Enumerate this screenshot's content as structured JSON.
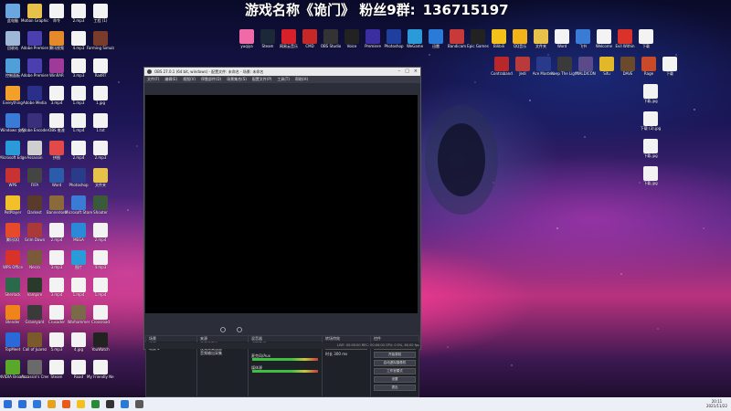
{
  "banner": {
    "game": "游戏名称《诡门》 粉丝9群:",
    "number": "136715197"
  },
  "obs": {
    "title": "OBS 27.0.1 (64 bit, windows) - 配置文件: 未命名 - 场景: 未命名",
    "menu": [
      "文件(F)",
      "编辑(E)",
      "视图(V)",
      "停靠部件(D)",
      "场景集合(S)",
      "配置文件(P)",
      "工具(T)",
      "帮助(H)"
    ],
    "docks": {
      "scenes_title": "场景",
      "scenes": [
        "场景",
        "场景 2"
      ],
      "sources_title": "来源",
      "sources": [
        "显示器采集",
        "视频采集设备",
        "音频输出采集"
      ],
      "mixer_title": "混音器",
      "mixer": [
        "桌面音频",
        "麦克风/Aux",
        "媒体源"
      ],
      "transitions_title": "转场特效",
      "transition_label": "淡入淡出",
      "duration_label": "时长",
      "duration_value": "300 ms",
      "controls_title": "控件",
      "controls": [
        "开始推流",
        "开始录制",
        "启动虚拟摄像机",
        "工作室模式",
        "设置",
        "退出"
      ]
    },
    "status": "LIVE: 00:00:00   REC: 00:00:00   CPU: 0.5%, 60.00 fps"
  },
  "desktop_left": [
    [
      "此电脑",
      "#6aa7e0"
    ],
    [
      "Motion Graphics",
      "#e7c24a"
    ],
    [
      "命令",
      "#f3f3f3"
    ],
    [
      "2.mp3",
      "#f3f3f3"
    ],
    [
      "工程 (1)",
      "#f3f3f3"
    ],
    [
      "回收站",
      "#9fb8d8"
    ],
    [
      "Adobe Premiere",
      "#4b3fb0"
    ],
    [
      "腾讯视频",
      "#e58a2b"
    ],
    [
      "4.mp3",
      "#f3f3f3"
    ],
    [
      "Farming Simulator",
      "#7a3b2a"
    ],
    [
      "控制面板",
      "#4fa0d8"
    ],
    [
      "Adobe Premiere",
      "#4b3fb0"
    ],
    [
      "WinRAR",
      "#a03a9a"
    ],
    [
      "3.mp3",
      "#f3f3f3"
    ],
    [
      "RadRT",
      "#f3f3f3"
    ],
    [
      "Everything",
      "#f2a02a"
    ],
    [
      "Adobe Media",
      "#2a2f8a"
    ],
    [
      "3.mp4",
      "#f3f3f3"
    ],
    [
      "1.mp3",
      "#f3f3f3"
    ],
    [
      "1.jpg",
      "#f3f3f3"
    ],
    [
      "Windows 安全",
      "#3a7bd5"
    ],
    [
      "Adobe Encoder",
      "#3a2f7a"
    ],
    [
      "OBS 推流",
      "#f3f3f3"
    ],
    [
      "1.mp4",
      "#f3f3f3"
    ],
    [
      "1.txt",
      "#f3f3f3"
    ],
    [
      "Microsoft Edge",
      "#2a9bd8"
    ],
    [
      "Assassin",
      "#cfcfcf"
    ],
    [
      "拼图",
      "#e24a4a"
    ],
    [
      "2.mp4",
      "#f3f3f3"
    ],
    [
      "2.mp3",
      "#f3f3f3"
    ],
    [
      "WPS",
      "#c83232"
    ],
    [
      "FIFA",
      "#444"
    ],
    [
      "Word",
      "#2a5caa"
    ],
    [
      "Photoshop",
      "#2a3b8a"
    ],
    [
      "文件夹",
      "#e7c24a"
    ],
    [
      "PotPlayer",
      "#f2c12a"
    ],
    [
      "Darkest",
      "#5a3a2a"
    ],
    [
      "Bannerlord",
      "#8a6a3a"
    ],
    [
      "Microsoft Store",
      "#3a7bd5"
    ],
    [
      "Shooter",
      "#3a5a3a"
    ],
    [
      "腾讯QQ",
      "#e64a2a"
    ],
    [
      "Grim Dawn",
      "#aa3a3a"
    ],
    [
      "2.mp4",
      "#f3f3f3"
    ],
    [
      "MEGA",
      "#2a8ad8"
    ],
    [
      "2.mp4",
      "#f3f3f3"
    ],
    [
      "WPS Office",
      "#d8322a"
    ],
    [
      "Necro",
      "#7a5a3a"
    ],
    [
      "3.mp3",
      "#f3f3f3"
    ],
    [
      "图片",
      "#2a9bd8"
    ],
    [
      "4.mp3",
      "#f3f3f3"
    ],
    [
      "Sherlock",
      "#2a6a4a"
    ],
    [
      "Vampire",
      "#2a3a2a"
    ],
    [
      "3.mp4",
      "#f3f3f3"
    ],
    [
      "1.mp4",
      "#f3f3f3"
    ],
    [
      "1.mp4",
      "#f3f3f3"
    ],
    [
      "Blender",
      "#f0841a"
    ],
    [
      "Graveyard",
      "#3a3a3a"
    ],
    [
      "Crusader",
      "#f3f3f3"
    ],
    [
      "Warhammer",
      "#7a6a4a"
    ],
    [
      "Crossroad",
      "#f3f3f3"
    ],
    [
      "TopMeet",
      "#2a6ad8"
    ],
    [
      "Call of Juarez",
      "#7a5a2a"
    ],
    [
      "5.mp3",
      "#f3f3f3"
    ],
    [
      "4.jpg",
      "#f3f3f3"
    ],
    [
      "YouWatch",
      "#222"
    ],
    [
      "NVIDIA Broadcast",
      "#5aa82a"
    ],
    [
      "Assassin's Creed",
      "#6a6a6a"
    ],
    [
      "Steam",
      "#f3f3f3"
    ],
    [
      "Road",
      "#f3f3f3"
    ],
    [
      "My Friendly Neighbor",
      "#f3f3f3"
    ]
  ],
  "desktop_top": [
    [
      "yuqiya",
      "#f06aa8"
    ],
    [
      "Steam",
      "#1b2838"
    ],
    [
      "网易云音乐",
      "#d8202a"
    ],
    [
      "CMD",
      "#c62828"
    ],
    [
      "OBS Studio",
      "#333"
    ],
    [
      "Voice",
      "#222"
    ],
    [
      "Premiere",
      "#3a2ea0"
    ],
    [
      "Photoshop",
      "#1f3f9f"
    ],
    [
      "WeGame",
      "#2a9bd8"
    ],
    [
      "迅雷",
      "#2a7bd8"
    ],
    [
      "Bandicam",
      "#c83a3a"
    ],
    [
      "Epic Games",
      "#222"
    ],
    [
      "Bilibili",
      "#f3c11a"
    ],
    [
      "QQ音乐",
      "#f2b21a"
    ],
    [
      "文件夹",
      "#e7c24a"
    ],
    [
      "Word",
      "#f3f3f3"
    ],
    [
      "飞书",
      "#3a7bd5"
    ],
    [
      "Welcome",
      "#f3f3f3"
    ],
    [
      "Evil Within",
      "#d8322a"
    ],
    [
      "下载",
      "#f3f3f3"
    ]
  ],
  "desktop_top2": [
    [
      "Contraband",
      "#b8282a"
    ],
    [
      "Jedi",
      "#b83a3a"
    ],
    [
      "Ace Masters",
      "#2a3a8a"
    ],
    [
      "Keep The Light",
      "#3a3a3a"
    ],
    [
      "MALDICON",
      "#5a4a8a"
    ],
    [
      "Sifu",
      "#e2b82a"
    ],
    [
      "DAVE",
      "#6a4a2a"
    ],
    [
      "Rage",
      "#c84a2a"
    ],
    [
      "下载",
      "#f3f3f3"
    ]
  ],
  "desktop_right": [
    [
      "下载.jpg",
      "#f3f3f3"
    ],
    [
      "下载 (3).jpg",
      "#f3f3f3"
    ],
    [
      "下载.jpg",
      "#f3f3f3"
    ],
    [
      "下载.jpg",
      "#f3f3f3"
    ]
  ],
  "taskbar": {
    "icons": [
      "#2b6fd8",
      "#2b6fd8",
      "#2f77d8",
      "#e6a21a",
      "#ea5a1a",
      "#f3c11a",
      "#2a8a3a",
      "#333",
      "#2a7bd5",
      "#5a5a5a"
    ],
    "clock": "20:11",
    "date": "2021/11/22"
  },
  "colors": {
    "taskbar": "#eceff5",
    "obs_bg": "#2b2e38",
    "preview": "#000000"
  }
}
